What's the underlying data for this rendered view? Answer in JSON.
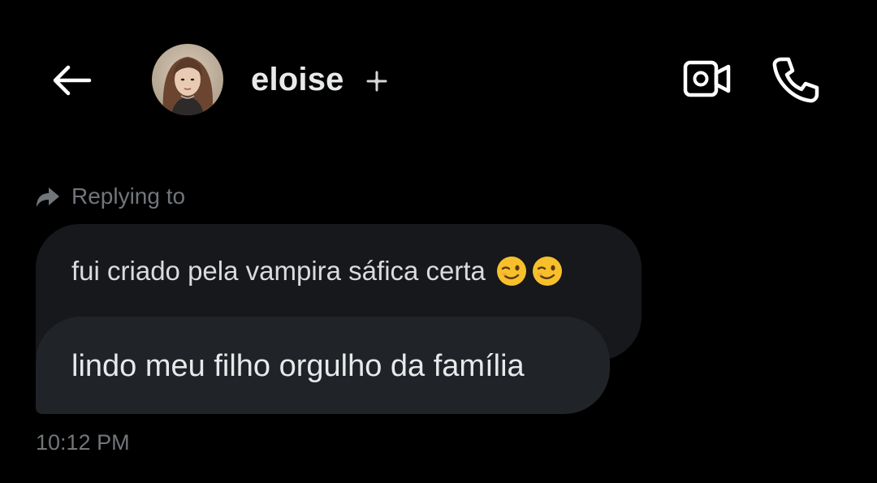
{
  "header": {
    "back_icon": "arrow-left-icon",
    "contact_name": "eloise",
    "badge_icon": "sparkle-icon",
    "video_icon": "video-camera-icon",
    "call_icon": "phone-icon"
  },
  "conversation": {
    "reply_label": "Replying to",
    "reply_icon": "reply-arrow-icon",
    "quoted_message": "fui criado pela vampira sáfica certa",
    "quoted_emojis": [
      "winking-face-emoji",
      "winking-face-emoji"
    ],
    "message": "lindo meu filho orgulho da família",
    "timestamp": "10:12 PM"
  },
  "colors": {
    "background": "#000000",
    "text_primary": "#e7e9ea",
    "text_secondary": "#71767b",
    "quoted_bubble": "#16181c",
    "message_bubble": "#202327"
  }
}
